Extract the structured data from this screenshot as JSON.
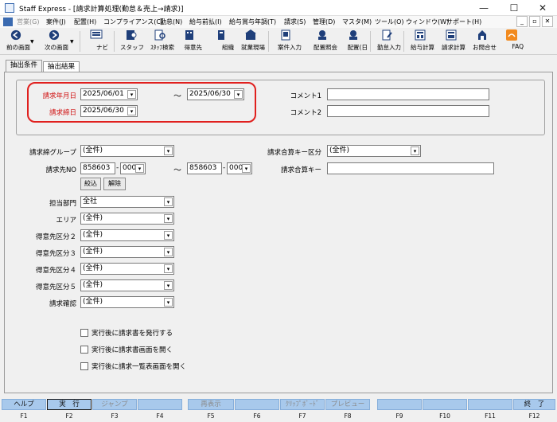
{
  "window": {
    "title": "Staff Express - [請求計算処理(勤怠＆売上→請求)]",
    "controls": {
      "minimize": "—",
      "maximize": "☐",
      "close": "✕"
    }
  },
  "menu": {
    "items": [
      {
        "label": "営業(G)",
        "enabled": false
      },
      {
        "label": "案件(J)",
        "enabled": true
      },
      {
        "label": "配置(H)",
        "enabled": true
      },
      {
        "label": "コンプライアンス(C)",
        "enabled": true
      },
      {
        "label": "勤怠(N)",
        "enabled": true
      },
      {
        "label": "給与前払(I)",
        "enabled": true
      },
      {
        "label": "給与賞与年調(T)",
        "enabled": true
      },
      {
        "label": "請求(S)",
        "enabled": true
      },
      {
        "label": "管理(D)",
        "enabled": true
      },
      {
        "label": "マスタ(M)",
        "enabled": true
      },
      {
        "label": "ツール(O)",
        "enabled": true
      },
      {
        "label": "ウィンドウ(W)",
        "enabled": true
      },
      {
        "label": "サポート(H)",
        "enabled": true
      }
    ],
    "mdi_controls": {
      "minimize": "_",
      "restore": "▫",
      "close": "✕"
    }
  },
  "toolbar": {
    "back": "前の画面",
    "forward": "次の画面",
    "buttons": [
      {
        "label": "ナビ",
        "icon": "navi-icon"
      },
      {
        "label": "スタッフ",
        "icon": "staff-icon"
      },
      {
        "label": "ｽﾀｯﾌ検索",
        "icon": "staff-search-icon"
      },
      {
        "label": "得意先",
        "icon": "client-icon"
      },
      {
        "label": "組織",
        "icon": "organization-icon"
      },
      {
        "label": "就業現場",
        "icon": "worksite-icon"
      },
      {
        "label": "案件入力",
        "icon": "case-entry-icon"
      },
      {
        "label": "配置照会",
        "icon": "placement-inquiry-icon"
      },
      {
        "label": "配置(日",
        "icon": "placement-daily-icon"
      },
      {
        "label": "勤怠入力",
        "icon": "attendance-entry-icon"
      },
      {
        "label": "給与計算",
        "icon": "payroll-calc-icon"
      },
      {
        "label": "請求計算",
        "icon": "billing-calc-icon"
      },
      {
        "label": "お問合せ",
        "icon": "inquiry-icon"
      },
      {
        "label": "FAQ",
        "icon": "faq-icon"
      }
    ]
  },
  "tabs": [
    {
      "label": "抽出条件",
      "active": true
    },
    {
      "label": "抽出結果",
      "active": false
    }
  ],
  "form": {
    "billing_month": {
      "label": "請求年月日",
      "from": "2025/06/01",
      "to": "2025/06/30"
    },
    "range_sep": "～",
    "closing_day": {
      "label": "請求締日",
      "value": "2025/06/30"
    },
    "comment1": {
      "label": "コメント1",
      "value": ""
    },
    "comment2": {
      "label": "コメント2",
      "value": ""
    },
    "closing_group": {
      "label": "請求締グループ",
      "value": "(全件)"
    },
    "aggregate_key_type": {
      "label": "請求合算キー区分",
      "value": "(全件)"
    },
    "billing_no": {
      "label": "請求先NO",
      "from_code": "858603",
      "from_branch": "000",
      "to_code": "858603",
      "to_branch": "000",
      "dash": "-"
    },
    "aggregate_key": {
      "label": "請求合算キー",
      "value": ""
    },
    "narrow_button": "絞込",
    "clear_button": "解除",
    "department": {
      "label": "担当部門",
      "value": "全社"
    },
    "area": {
      "label": "エリア",
      "value": "(全件)"
    },
    "client_class2": {
      "label": "得意先区分２",
      "value": "(全件)"
    },
    "client_class3": {
      "label": "得意先区分３",
      "value": "(全件)"
    },
    "client_class4": {
      "label": "得意先区分４",
      "value": "(全件)"
    },
    "client_class5": {
      "label": "得意先区分５",
      "value": "(全件)"
    },
    "billing_confirm": {
      "label": "請求確認",
      "value": "(全件)"
    },
    "options": [
      {
        "label": "実行後に請求書を発行する",
        "checked": false
      },
      {
        "label": "実行後に請求書画面を開く",
        "checked": false
      },
      {
        "label": "実行後に請求一覧表画面を開く",
        "checked": false
      }
    ]
  },
  "function_keys": [
    {
      "label": "ヘルプ",
      "key": "F1",
      "enabled": true
    },
    {
      "label": "実　行",
      "key": "F2",
      "enabled": true
    },
    {
      "label": "ジャンプ",
      "key": "F3",
      "enabled": false
    },
    {
      "label": "",
      "key": "F4",
      "enabled": false
    },
    {
      "label": "再表示",
      "key": "F5",
      "enabled": false
    },
    {
      "label": "",
      "key": "F6",
      "enabled": false
    },
    {
      "label": "ｸﾘｯﾌﾟﾎﾞｰﾄﾞ",
      "key": "F7",
      "enabled": false
    },
    {
      "label": "プレビュー",
      "key": "F8",
      "enabled": false
    },
    {
      "label": "",
      "key": "F9",
      "enabled": false
    },
    {
      "label": "",
      "key": "F10",
      "enabled": false
    },
    {
      "label": "",
      "key": "F11",
      "enabled": false
    },
    {
      "label": "終　了",
      "key": "F12",
      "enabled": true
    }
  ],
  "colors": {
    "highlight": "#e0201e",
    "label_red": "#d01010",
    "fkey_bar": "#a8c9ec"
  }
}
